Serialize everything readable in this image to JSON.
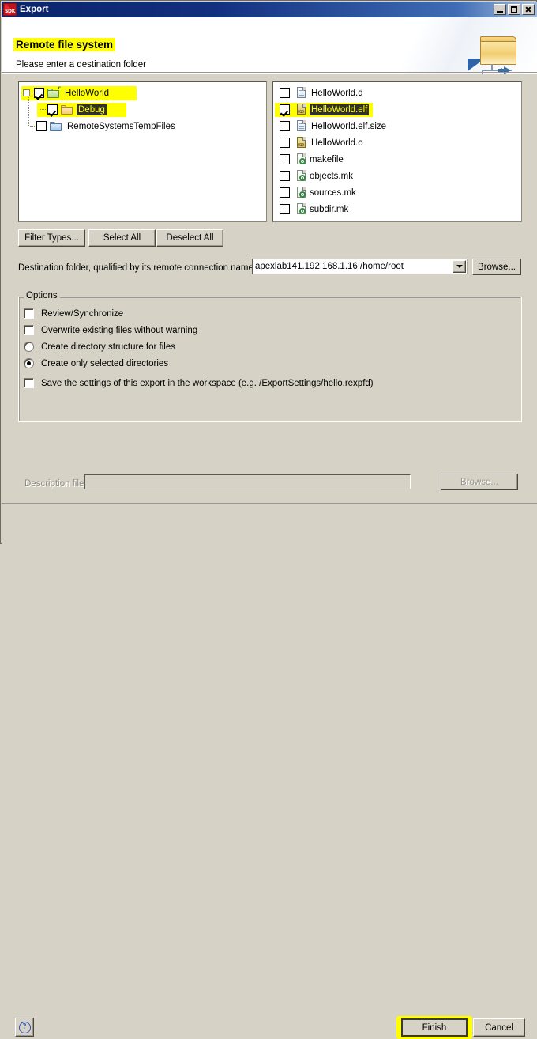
{
  "window": {
    "title": "Export",
    "app_icon": "sdk-icon",
    "minimize_label": "Minimize",
    "maximize_label": "Maximize",
    "close_label": "Close"
  },
  "banner": {
    "title": "Remote file system",
    "subtitle": "Please enter a destination folder",
    "icon": "export-folder-network-icon"
  },
  "tree": {
    "items": [
      {
        "label": "HelloWorld",
        "checked": true,
        "folder": "green",
        "indent": 0,
        "expander": true,
        "highlight": true,
        "badge": "c"
      },
      {
        "label": "Debug",
        "checked": true,
        "folder": "orange",
        "indent": 1,
        "expander": false,
        "highlight": true,
        "selected": true
      },
      {
        "label": "RemoteSystemsTempFiles",
        "checked": false,
        "folder": "blue",
        "indent": 1,
        "expander": false,
        "highlight": false
      }
    ]
  },
  "files": {
    "items": [
      {
        "label": "HelloWorld.d",
        "checked": false,
        "icon": "document-icon",
        "highlight": false
      },
      {
        "label": "HelloWorld.elf",
        "checked": true,
        "icon": "binary-file-icon",
        "highlight": true,
        "selected": true
      },
      {
        "label": "HelloWorld.elf.size",
        "checked": false,
        "icon": "document-icon",
        "highlight": false
      },
      {
        "label": "HelloWorld.o",
        "checked": false,
        "icon": "binary-file-icon",
        "highlight": false
      },
      {
        "label": "makefile",
        "checked": false,
        "icon": "makefile-icon",
        "highlight": false
      },
      {
        "label": "objects.mk",
        "checked": false,
        "icon": "makefile-icon",
        "highlight": false
      },
      {
        "label": "sources.mk",
        "checked": false,
        "icon": "makefile-icon",
        "highlight": false
      },
      {
        "label": "subdir.mk",
        "checked": false,
        "icon": "makefile-icon",
        "highlight": false
      }
    ]
  },
  "buttons": {
    "filter_types": "Filter Types...",
    "select_all": "Select All",
    "deselect_all": "Deselect All",
    "browse_destination": "Browse...",
    "browse_description": "Browse...",
    "finish": "Finish",
    "cancel": "Cancel"
  },
  "destination": {
    "label": "Destination folder, qualified by its remote connection name:",
    "value": "apexlab141.192.168.1.16:/home/root",
    "dropdown_icon": "chevron-down-icon"
  },
  "options": {
    "title": "Options",
    "items": [
      {
        "type": "checkbox",
        "label": "Review/Synchronize",
        "checked": false
      },
      {
        "type": "checkbox",
        "label": "Overwrite existing files without warning",
        "checked": false
      },
      {
        "type": "radio",
        "label": "Create directory structure for files",
        "checked": false
      },
      {
        "type": "radio",
        "label": "Create only selected directories",
        "checked": true
      },
      {
        "type": "checkbox",
        "label": "Save the settings of this export in the workspace (e.g. /ExportSettings/hello.rexpfd)",
        "checked": false
      }
    ],
    "description_label": "Description file:",
    "description_value": "",
    "description_disabled": true
  },
  "status": {
    "icon": "info-icon",
    "message": "Please enter a destination folder",
    "help_icon": "question-mark-icon"
  },
  "footer": {
    "help_icon": "question-mark-icon"
  },
  "colors": {
    "highlight": "#ffff00",
    "dialog_bg": "#d6d2c6",
    "title_bar": "#0a246a",
    "info_blue": "#2b4fb5",
    "selection_bg": "#31312a",
    "selection_fg": "#ffff00"
  }
}
